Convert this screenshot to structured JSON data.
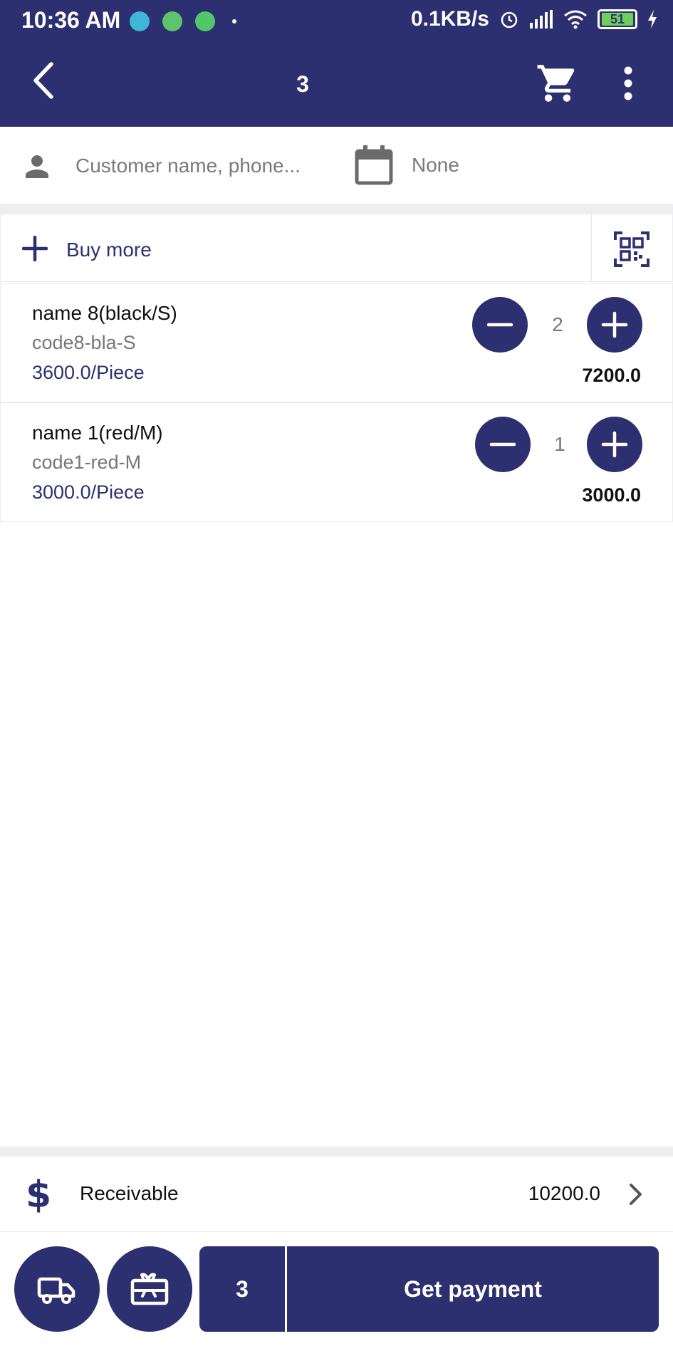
{
  "status_bar": {
    "time": "10:36 AM",
    "network_speed": "0.1KB/s",
    "battery_level": "51"
  },
  "app_bar": {
    "title": "3",
    "icons": [
      "back-icon",
      "cart-icon",
      "more-vert-icon"
    ]
  },
  "customer": {
    "placeholder": "Customer name, phone...",
    "date_value": "None"
  },
  "buy_more": {
    "label": "Buy more"
  },
  "items": [
    {
      "name": "name 8(black/S)",
      "code": "code8-bla-S",
      "price": "3600.0/Piece",
      "quantity": "2",
      "total": "7200.0"
    },
    {
      "name": "name 1(red/M)",
      "code": "code1-red-M",
      "price": "3000.0/Piece",
      "quantity": "1",
      "total": "3000.0"
    }
  ],
  "receivable": {
    "label": "Receivable",
    "value": "10200.0"
  },
  "bottom_bar": {
    "count": "3",
    "pay_label": "Get payment"
  },
  "colors": {
    "primary": "#2c3070",
    "divider": "#eceef3",
    "muted_text": "#777777"
  }
}
